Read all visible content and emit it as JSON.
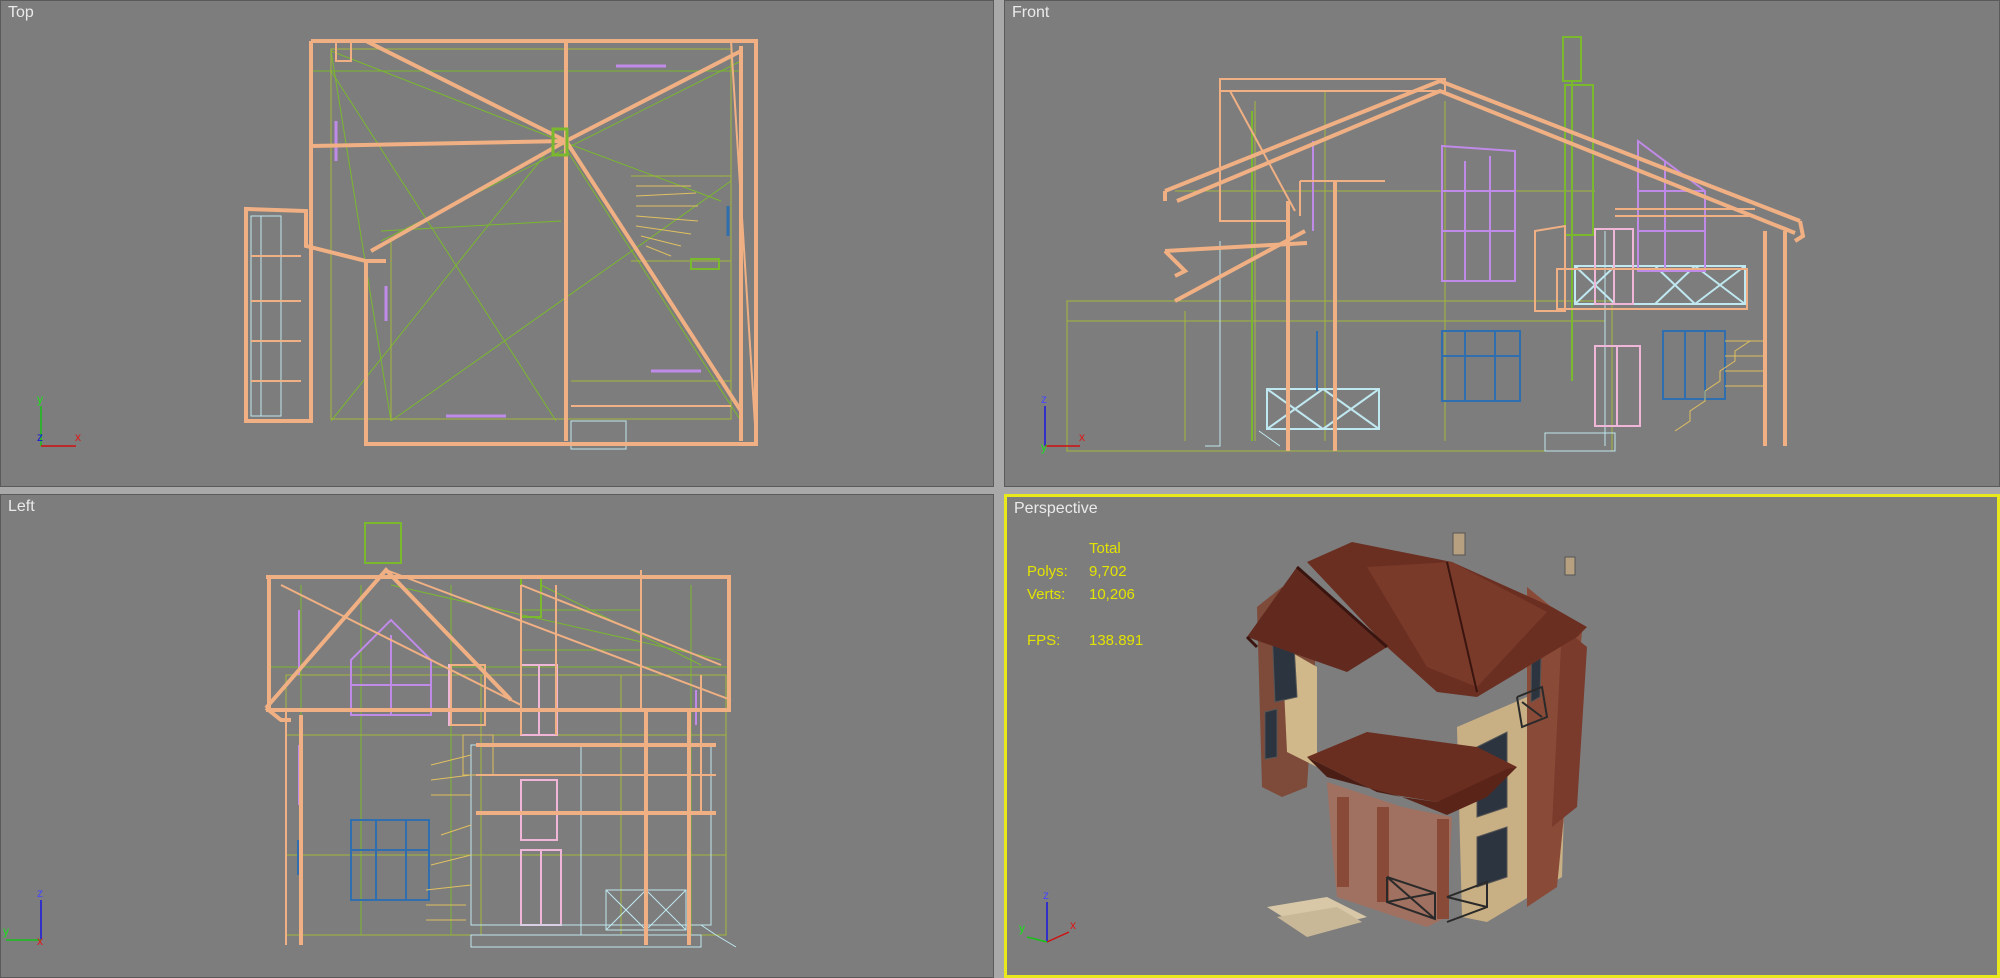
{
  "viewports": {
    "top": {
      "label": "Top",
      "axes": [
        "y",
        "x",
        "z"
      ]
    },
    "front": {
      "label": "Front",
      "axes": [
        "z",
        "y",
        "x"
      ]
    },
    "left": {
      "label": "Left",
      "axes": [
        "z",
        "y",
        "x"
      ]
    },
    "perspective": {
      "label": "Perspective",
      "active": true,
      "axes": [
        "z",
        "y",
        "x"
      ],
      "stats": {
        "header": "Total",
        "polys_label": "Polys:",
        "polys_value": "9,702",
        "verts_label": "Verts:",
        "verts_value": "10,206",
        "fps_label": "FPS:",
        "fps_value": "138.891"
      }
    }
  },
  "colors": {
    "viewport_bg": "#7d7d7d",
    "active_border": "#e8e81c",
    "wire_orange": "#f0b083",
    "wire_green": "#7ab82e",
    "wire_lime": "#a4b83a",
    "wire_purple": "#c08ae8",
    "wire_blue": "#2f6fb0",
    "wire_pink": "#f0b6d8",
    "wire_cyan": "#bfe8f0",
    "wire_yellow": "#e0c060",
    "stats_text": "#e3e300"
  }
}
